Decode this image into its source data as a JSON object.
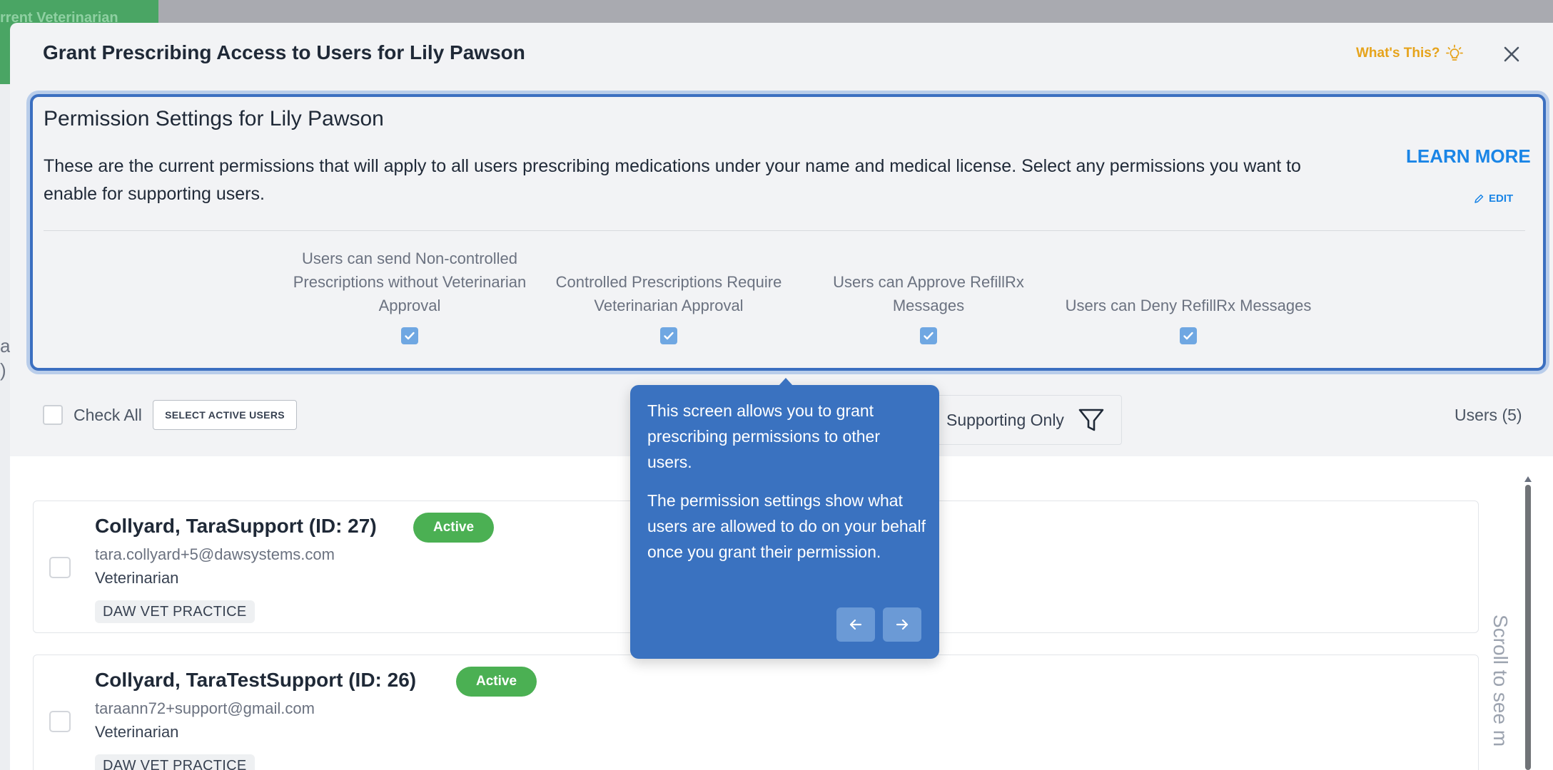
{
  "background": {
    "banner_text": "rrent Veterinarian",
    "left_fragment_1": "a",
    "left_fragment_2": ")"
  },
  "modal": {
    "title": "Grant Prescribing Access to Users for Lily Pawson",
    "whats_this": "What's This?",
    "close_icon": "close-icon"
  },
  "permissions": {
    "title": "Permission Settings for Lily Pawson",
    "description": "These are the current permissions that will apply to all users prescribing medications under your name and medical license. Select any permissions you want to enable for supporting users.",
    "learn_more": "LEARN MORE",
    "edit": "EDIT",
    "options": [
      {
        "label": "Users can send Non-controlled Prescriptions without Veterinarian Approval",
        "checked": true
      },
      {
        "label": "Controlled Prescriptions Require Veterinarian Approval",
        "checked": true
      },
      {
        "label": "Users can Approve RefillRx Messages",
        "checked": true
      },
      {
        "label": "Users can Deny RefillRx Messages",
        "checked": true
      }
    ]
  },
  "filters": {
    "check_all": "Check All",
    "select_active": "SELECT ACTIVE USERS",
    "supporting_only": "Supporting Only",
    "users_count": "Users (5)"
  },
  "users": [
    {
      "name": "Collyard, TaraSupport (ID: 27)",
      "status": "Active",
      "email": "tara.collyard+5@dawsystems.com",
      "role": "Veterinarian",
      "practice": "DAW VET PRACTICE"
    },
    {
      "name": "Collyard, TaraTestSupport (ID: 26)",
      "status": "Active",
      "email": "taraann72+support@gmail.com",
      "role": "Veterinarian",
      "practice": "DAW VET PRACTICE"
    }
  ],
  "scroll_hint": "Scroll to see m",
  "tooltip": {
    "paragraph_1": "This screen allows you to grant prescribing permissions to other users.",
    "paragraph_2": "The permission settings show what users are allowed to do on your behalf once you grant their permission."
  },
  "colors": {
    "accent_blue": "#3a72c0",
    "link_blue": "#1a85e6",
    "active_green": "#4bb053",
    "whats_this_yellow": "#e6a31b"
  }
}
